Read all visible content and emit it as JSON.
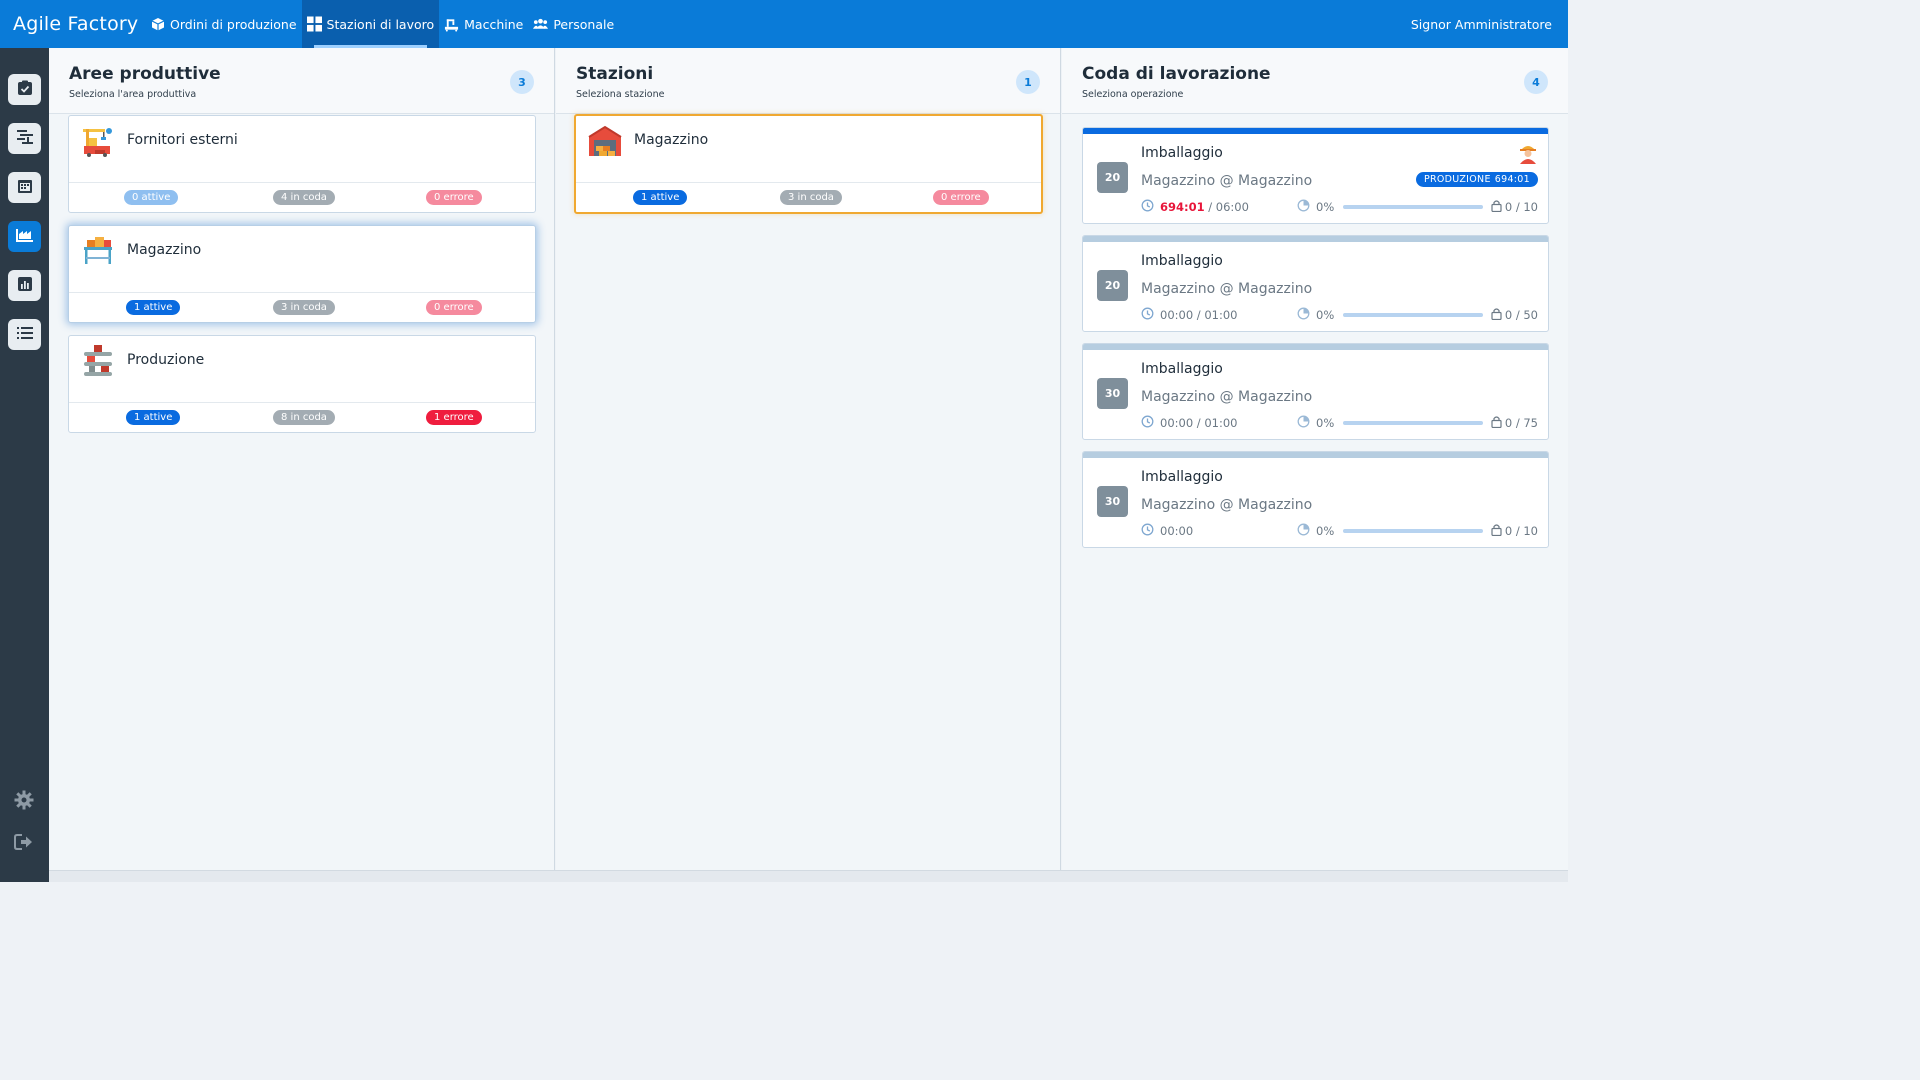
{
  "app": {
    "brand": "Agile Factory",
    "user": "Signor Amministratore",
    "nav": [
      {
        "label": "Ordini di produzione",
        "icon": "cube-icon"
      },
      {
        "label": "Stazioni di lavoro",
        "icon": "grid-icon",
        "active": true
      },
      {
        "label": "Macchine",
        "icon": "machine-icon"
      },
      {
        "label": "Personale",
        "icon": "people-icon"
      }
    ]
  },
  "sidebar": {
    "items": [
      "checklist-icon",
      "gantt-icon",
      "calendar-icon",
      "factory-chart-icon",
      "bar-chart-icon",
      "list-icon"
    ],
    "active": "factory-chart-icon",
    "bottom": [
      "gear-icon",
      "logout-icon"
    ]
  },
  "areas": {
    "title": "Aree produttive",
    "subtitle": "Seleziona l'area produttiva",
    "count": "3",
    "items": [
      {
        "name": "Fornitori esterni",
        "active": "0 attive",
        "queue": "4 in coda",
        "errors": "0 errore"
      },
      {
        "name": "Magazzino",
        "active": "1 attive",
        "queue": "3 in coda",
        "errors": "0 errore"
      },
      {
        "name": "Produzione",
        "active": "1 attive",
        "queue": "8 in coda",
        "errors": "1 errore"
      }
    ]
  },
  "stations": {
    "title": "Stazioni",
    "subtitle": "Seleziona stazione",
    "count": "1",
    "items": [
      {
        "name": "Magazzino",
        "active": "1 attive",
        "queue": "3 in coda",
        "errors": "0 errore"
      }
    ]
  },
  "queue": {
    "title": "Coda di lavorazione",
    "subtitle": "Seleziona operazione",
    "count": "4",
    "items": [
      {
        "num": "20",
        "title": "Imballaggio",
        "location": "Magazzino @ Magazzino",
        "time_elapsed": "694:01",
        "time_planned": "/ 06:00",
        "percent": "0%",
        "progress": 0,
        "qty": "0 / 10",
        "badge_label": "PRODUZIONE",
        "badge_time": "694:01",
        "active": true
      },
      {
        "num": "20",
        "title": "Imballaggio",
        "location": "Magazzino @ Magazzino",
        "time": "00:00 / 01:00",
        "percent": "0%",
        "progress": 0,
        "qty": "0 / 50"
      },
      {
        "num": "30",
        "title": "Imballaggio",
        "location": "Magazzino @ Magazzino",
        "time": "00:00 / 01:00",
        "percent": "0%",
        "progress": 0,
        "qty": "0 / 75"
      },
      {
        "num": "30",
        "title": "Imballaggio",
        "location": "Magazzino @ Magazzino",
        "time": "00:00",
        "percent": "0%",
        "progress": 0,
        "qty": "0 / 10"
      }
    ]
  },
  "colors": {
    "primary": "#0a7bd8",
    "primary_dark": "#0a5fae",
    "sidebar": "#2c3a47",
    "error": "#ef1d3e",
    "selected_orange": "#f0a830"
  }
}
